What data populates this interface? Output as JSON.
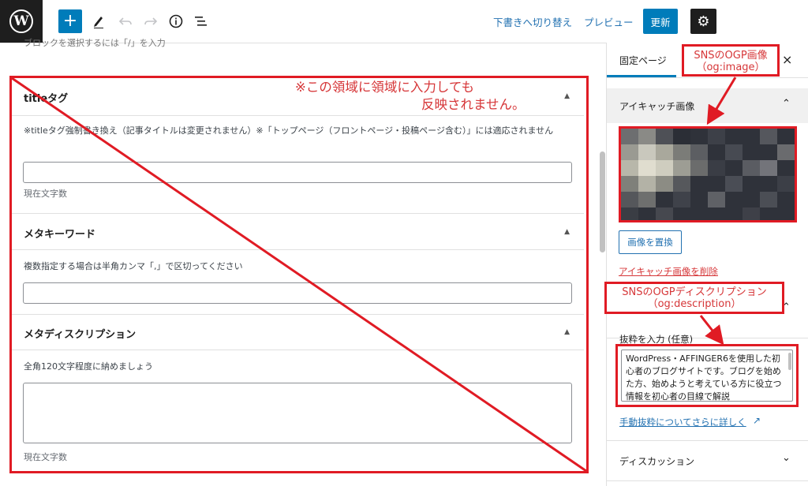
{
  "toolbar": {
    "add_label": "+",
    "switch_draft": "下書きへ切り替え",
    "preview": "プレビュー",
    "update": "更新"
  },
  "editor": {
    "hint": "ブロックを選択するには「/」を入力",
    "notice_line1": "※この領域に領域に入力しても",
    "notice_line2": "反映されません。",
    "sections": [
      {
        "title": "titleタグ",
        "description": "※titleタグ強制書き換え（記事タイトルは変更されません）※「トップページ（フロントページ・投稿ページ含む）」には適応されません",
        "value": "",
        "counter_label": "現在文字数"
      },
      {
        "title": "メタキーワード",
        "description": "複数指定する場合は半角カンマ「,」で区切ってください",
        "value": ""
      },
      {
        "title": "メタディスクリプション",
        "description": "全角120文字程度に納めましょう",
        "value": "",
        "counter_label": "現在文字数"
      }
    ]
  },
  "sidebar": {
    "tab_page": "固定ページ",
    "close": "×",
    "featured_image": {
      "title": "アイキャッチ画像",
      "replace_button": "画像を置換",
      "remove_link": "アイキャッチ画像を削除"
    },
    "excerpt": {
      "label": "抜粋を入力 (任意)",
      "value": "WordPress・AFFINGER6を使用した初心者のブログサイトです。ブログを始めた方、始めようと考えている方に役立つ情報を初心者の目線で解説",
      "learn_more": "手動抜粋についてさらに詳しく"
    },
    "discussion": "ディスカッション"
  },
  "callouts": {
    "og_image_line1": "SNSのOGP画像",
    "og_image_line2": "（og:image）",
    "og_desc_line1": "SNSのOGPディスクリプション",
    "og_desc_line2": "（og:description）"
  },
  "colors": {
    "accent": "#007cba",
    "link": "#2271b1",
    "annotation_red": "#e01b24"
  }
}
